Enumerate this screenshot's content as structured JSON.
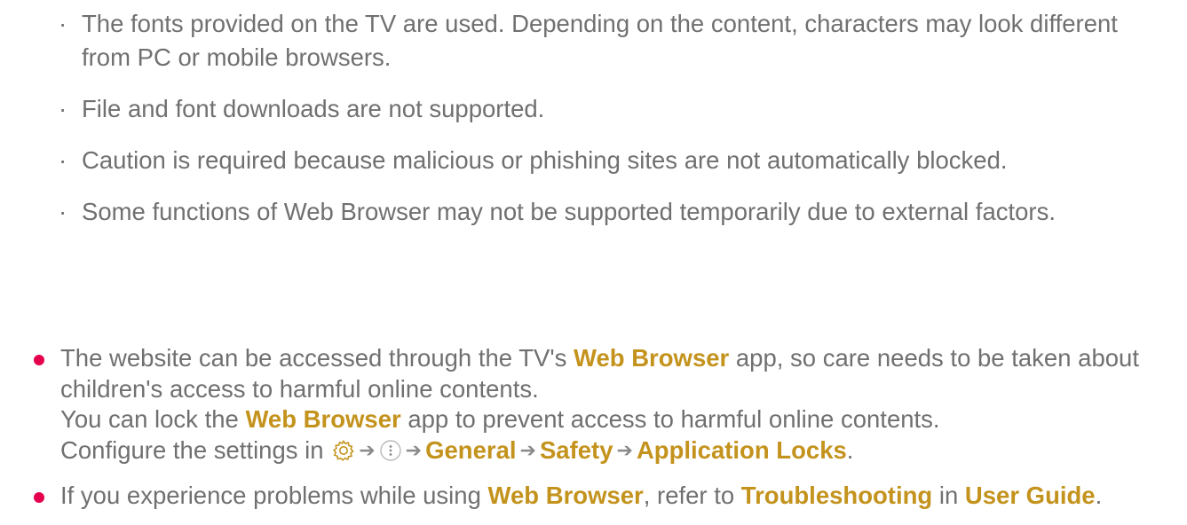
{
  "sub_points": [
    "The fonts provided on the TV are used. Depending on the content, characters may look different from PC or mobile browsers.",
    "File and font downloads are not supported.",
    "Caution is required because malicious or phishing sites are not automatically blocked.",
    "Some functions of Web Browser may not be supported temporarily due to external factors."
  ],
  "sub_bullet_glyph": "·",
  "note1": {
    "part1": "The website can be accessed through the TV's ",
    "app_name_1": "Web Browser",
    "part2": " app, so care needs to be taken about children's access to harmful online contents.",
    "line2_part1": "You can lock the ",
    "app_name_2": "Web Browser",
    "line2_part2": " app to prevent access to harmful online contents.",
    "line3_prefix": "Configure the settings in ",
    "path_general": "General",
    "path_safety": "Safety",
    "path_app_locks": "Application Locks",
    "line3_suffix": ".",
    "arrow": "➔",
    "icons": [
      "gear-icon",
      "more-options-icon"
    ]
  },
  "note2": {
    "part1": "If you experience problems while using ",
    "app_name": "Web Browser",
    "part2": ", refer to ",
    "troubleshooting": "Troubleshooting",
    "part3": " in ",
    "user_guide": "User Guide",
    "part4": "."
  },
  "colors": {
    "body_text": "#707070",
    "highlight": "#c4931d",
    "bullet": "#e5004f"
  }
}
